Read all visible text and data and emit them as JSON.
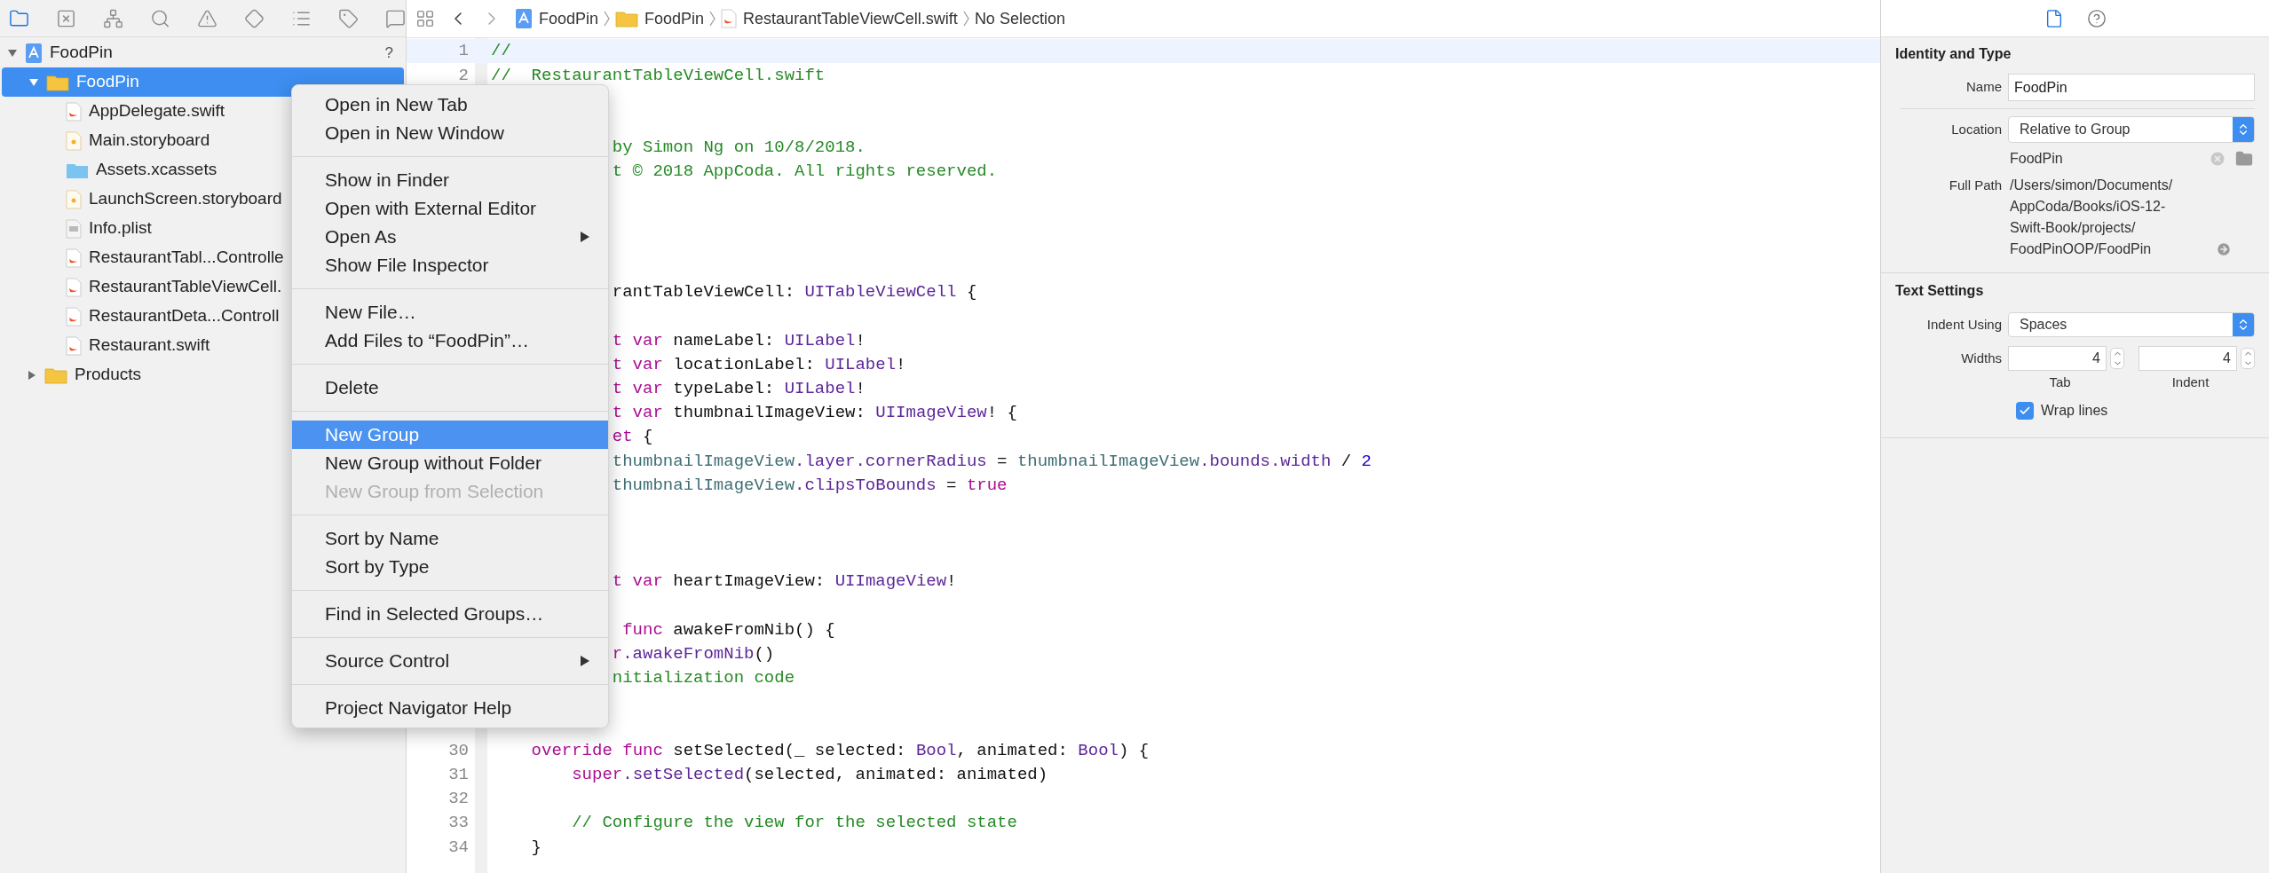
{
  "navigator": {
    "toolbar": [
      {
        "selected": true
      },
      {
        "selected": false
      },
      {
        "selected": false
      },
      {
        "selected": false
      },
      {
        "selected": false
      },
      {
        "selected": false
      },
      {
        "selected": false
      },
      {
        "selected": false
      },
      {
        "selected": false
      }
    ],
    "tree": [
      {
        "label": "FoodPin",
        "kind": "project",
        "badge": "?",
        "expanded": true,
        "selected": false,
        "children": [
          {
            "label": "FoodPin",
            "kind": "group",
            "expanded": true,
            "selected": true,
            "children": [
              {
                "label": "AppDelegate.swift",
                "kind": "swift",
                "selected": false
              },
              {
                "label": "Main.storyboard",
                "kind": "storyboard",
                "selected": false
              },
              {
                "label": "Assets.xcassets",
                "kind": "assets",
                "selected": false
              },
              {
                "label": "LaunchScreen.storyboard",
                "kind": "storyboard",
                "selected": false
              },
              {
                "label": "Info.plist",
                "kind": "plist",
                "selected": false
              },
              {
                "label": "RestaurantTabl...Controlle",
                "kind": "swift",
                "selected": false
              },
              {
                "label": "RestaurantTableViewCell.",
                "kind": "swift",
                "selected": false
              },
              {
                "label": "RestaurantDeta...Controll",
                "kind": "swift",
                "selected": false
              },
              {
                "label": "Restaurant.swift",
                "kind": "swift",
                "selected": false
              }
            ]
          },
          {
            "label": "Products",
            "kind": "group",
            "expanded": false,
            "selected": false
          }
        ]
      }
    ]
  },
  "jump_bar": {
    "crumbs": [
      {
        "label": "FoodPin",
        "kind": "project"
      },
      {
        "label": "FoodPin",
        "kind": "group"
      },
      {
        "label": "RestaurantTableViewCell.swift",
        "kind": "swift"
      },
      {
        "label": "No Selection",
        "kind": "none"
      }
    ]
  },
  "editor": {
    "lines": [
      {
        "kind": "line",
        "number": "1",
        "current": true,
        "tokens": [
          {
            "text": "//",
            "kind": "comment"
          }
        ]
      },
      {
        "kind": "line",
        "number": "2",
        "current": false,
        "tokens": [
          {
            "text": "//  RestaurantTableViewCell.swift",
            "kind": "comment"
          }
        ]
      },
      {
        "kind": "covered"
      },
      {
        "kind": "covered"
      },
      {
        "kind": "covered",
        "tokens": [
          {
            "text": "by Simon Ng on 10/8/2018.",
            "kind": "comment"
          }
        ]
      },
      {
        "kind": "covered",
        "tokens": [
          {
            "text": "t © 2018 AppCoda. All rights reserved.",
            "kind": "comment"
          }
        ]
      },
      {
        "kind": "covered"
      },
      {
        "kind": "covered"
      },
      {
        "kind": "covered"
      },
      {
        "kind": "covered"
      },
      {
        "kind": "covered",
        "tokens": [
          {
            "text": "rantTableViewCell: ",
            "kind": "plain"
          },
          {
            "text": "UITableViewCell",
            "kind": "type"
          },
          {
            "text": " {",
            "kind": "plain"
          }
        ]
      },
      {
        "kind": "covered"
      },
      {
        "kind": "covered",
        "tokens": [
          {
            "text": "t var",
            "kind": "keyword"
          },
          {
            "text": " nameLabel: ",
            "kind": "plain"
          },
          {
            "text": "UILabel",
            "kind": "type"
          },
          {
            "text": "!",
            "kind": "plain"
          }
        ]
      },
      {
        "kind": "covered",
        "tokens": [
          {
            "text": "t var",
            "kind": "keyword"
          },
          {
            "text": " locationLabel: ",
            "kind": "plain"
          },
          {
            "text": "UILabel",
            "kind": "type"
          },
          {
            "text": "!",
            "kind": "plain"
          }
        ]
      },
      {
        "kind": "covered",
        "tokens": [
          {
            "text": "t var",
            "kind": "keyword"
          },
          {
            "text": " typeLabel: ",
            "kind": "plain"
          },
          {
            "text": "UILabel",
            "kind": "type"
          },
          {
            "text": "!",
            "kind": "plain"
          }
        ]
      },
      {
        "kind": "covered",
        "tokens": [
          {
            "text": "t var",
            "kind": "keyword"
          },
          {
            "text": " thumbnailImageView: ",
            "kind": "plain"
          },
          {
            "text": "UIImageView",
            "kind": "type"
          },
          {
            "text": "! {",
            "kind": "plain"
          }
        ]
      },
      {
        "kind": "covered",
        "tokens": [
          {
            "text": "et",
            "kind": "keyword"
          },
          {
            "text": " {",
            "kind": "plain"
          }
        ]
      },
      {
        "kind": "covered",
        "tokens": [
          {
            "text": "thumbnailImageView",
            "kind": "ident"
          },
          {
            "text": ".layer.cornerRadius",
            "kind": "type"
          },
          {
            "text": " = ",
            "kind": "plain"
          },
          {
            "text": "thumbnailImageView",
            "kind": "ident"
          },
          {
            "text": ".bounds.width",
            "kind": "type"
          },
          {
            "text": " / ",
            "kind": "plain"
          },
          {
            "text": "2",
            "kind": "number"
          }
        ]
      },
      {
        "kind": "covered",
        "tokens": [
          {
            "text": "thumbnailImageView",
            "kind": "ident"
          },
          {
            "text": ".clipsToBounds",
            "kind": "type"
          },
          {
            "text": " = ",
            "kind": "plain"
          },
          {
            "text": "true",
            "kind": "keyword"
          }
        ]
      },
      {
        "kind": "covered"
      },
      {
        "kind": "covered"
      },
      {
        "kind": "covered"
      },
      {
        "kind": "covered",
        "tokens": [
          {
            "text": "t var",
            "kind": "keyword"
          },
          {
            "text": " heartImageView: ",
            "kind": "plain"
          },
          {
            "text": "UIImageView",
            "kind": "type"
          },
          {
            "text": "!",
            "kind": "plain"
          }
        ]
      },
      {
        "kind": "covered"
      },
      {
        "kind": "covered",
        "tokens": [
          {
            "text": " func",
            "kind": "keyword"
          },
          {
            "text": " awakeFromNib() {",
            "kind": "plain"
          }
        ]
      },
      {
        "kind": "covered",
        "tokens": [
          {
            "text": "r",
            "kind": "keyword"
          },
          {
            "text": ".awakeFromNib",
            "kind": "type"
          },
          {
            "text": "()",
            "kind": "plain"
          }
        ]
      },
      {
        "kind": "covered",
        "tokens": [
          {
            "text": "nitialization code",
            "kind": "comment"
          }
        ]
      },
      {
        "kind": "covered"
      },
      {
        "kind": "covered"
      },
      {
        "kind": "line",
        "number": "30",
        "current": false,
        "tokens": [
          {
            "text": "    override func",
            "kind": "keyword"
          },
          {
            "text": " setSelected(_ selected: ",
            "kind": "plain"
          },
          {
            "text": "Bool",
            "kind": "type"
          },
          {
            "text": ", animated: ",
            "kind": "plain"
          },
          {
            "text": "Bool",
            "kind": "type"
          },
          {
            "text": ") {",
            "kind": "plain"
          }
        ]
      },
      {
        "kind": "line",
        "number": "31",
        "current": false,
        "tokens": [
          {
            "text": "        super",
            "kind": "keyword"
          },
          {
            "text": ".setSelected",
            "kind": "type"
          },
          {
            "text": "(selected, animated: animated)",
            "kind": "plain"
          }
        ]
      },
      {
        "kind": "line",
        "number": "32",
        "current": false
      },
      {
        "kind": "line",
        "number": "33",
        "current": false,
        "tokens": [
          {
            "text": "        // Configure the view for the selected state",
            "kind": "comment"
          }
        ]
      },
      {
        "kind": "line",
        "number": "34",
        "current": false,
        "tokens": [
          {
            "text": "    }",
            "kind": "plain"
          }
        ]
      }
    ]
  },
  "context_menu": {
    "groups": [
      [
        {
          "label": "Open in New Tab",
          "selected": false,
          "disabled": false,
          "submenu": false
        },
        {
          "label": "Open in New Window",
          "selected": false,
          "disabled": false,
          "submenu": false
        }
      ],
      [
        {
          "label": "Show in Finder",
          "selected": false,
          "disabled": false,
          "submenu": false
        },
        {
          "label": "Open with External Editor",
          "selected": false,
          "disabled": false,
          "submenu": false
        },
        {
          "label": "Open As",
          "selected": false,
          "disabled": false,
          "submenu": true
        },
        {
          "label": "Show File Inspector",
          "selected": false,
          "disabled": false,
          "submenu": false
        }
      ],
      [
        {
          "label": "New File…",
          "selected": false,
          "disabled": false,
          "submenu": false
        },
        {
          "label": "Add Files to “FoodPin”…",
          "selected": false,
          "disabled": false,
          "submenu": false
        }
      ],
      [
        {
          "label": "Delete",
          "selected": false,
          "disabled": false,
          "submenu": false
        }
      ],
      [
        {
          "label": "New Group",
          "selected": true,
          "disabled": false,
          "submenu": false
        },
        {
          "label": "New Group without Folder",
          "selected": false,
          "disabled": false,
          "submenu": false
        },
        {
          "label": "New Group from Selection",
          "selected": false,
          "disabled": true,
          "submenu": false
        }
      ],
      [
        {
          "label": "Sort by Name",
          "selected": false,
          "disabled": false,
          "submenu": false
        },
        {
          "label": "Sort by Type",
          "selected": false,
          "disabled": false,
          "submenu": false
        }
      ],
      [
        {
          "label": "Find in Selected Groups…",
          "selected": false,
          "disabled": false,
          "submenu": false
        }
      ],
      [
        {
          "label": "Source Control",
          "selected": false,
          "disabled": false,
          "submenu": true
        }
      ],
      [
        {
          "label": "Project Navigator Help",
          "selected": false,
          "disabled": false,
          "submenu": false
        }
      ]
    ]
  },
  "inspector": {
    "tabs": [
      {
        "selected": true
      },
      {
        "selected": false
      }
    ],
    "identity": {
      "title": "Identity and Type",
      "name_label": "Name",
      "name_value": "FoodPin",
      "location_label": "Location",
      "location_value": "Relative to Group",
      "location_path": "FoodPin",
      "full_path_label": "Full Path",
      "full_path": [
        "/Users/simon/Documents/",
        "AppCoda/Books/iOS-12-",
        "Swift-Book/projects/",
        "FoodPinOOP/FoodPin"
      ]
    },
    "text_settings": {
      "title": "Text Settings",
      "indent_label": "Indent Using",
      "indent_value": "Spaces",
      "widths_label": "Widths",
      "tab_value": "4",
      "tab_label": "Tab",
      "indent_width_value": "4",
      "indent_width_label": "Indent",
      "wrap_label": "Wrap lines",
      "wrap_checked": true
    }
  }
}
